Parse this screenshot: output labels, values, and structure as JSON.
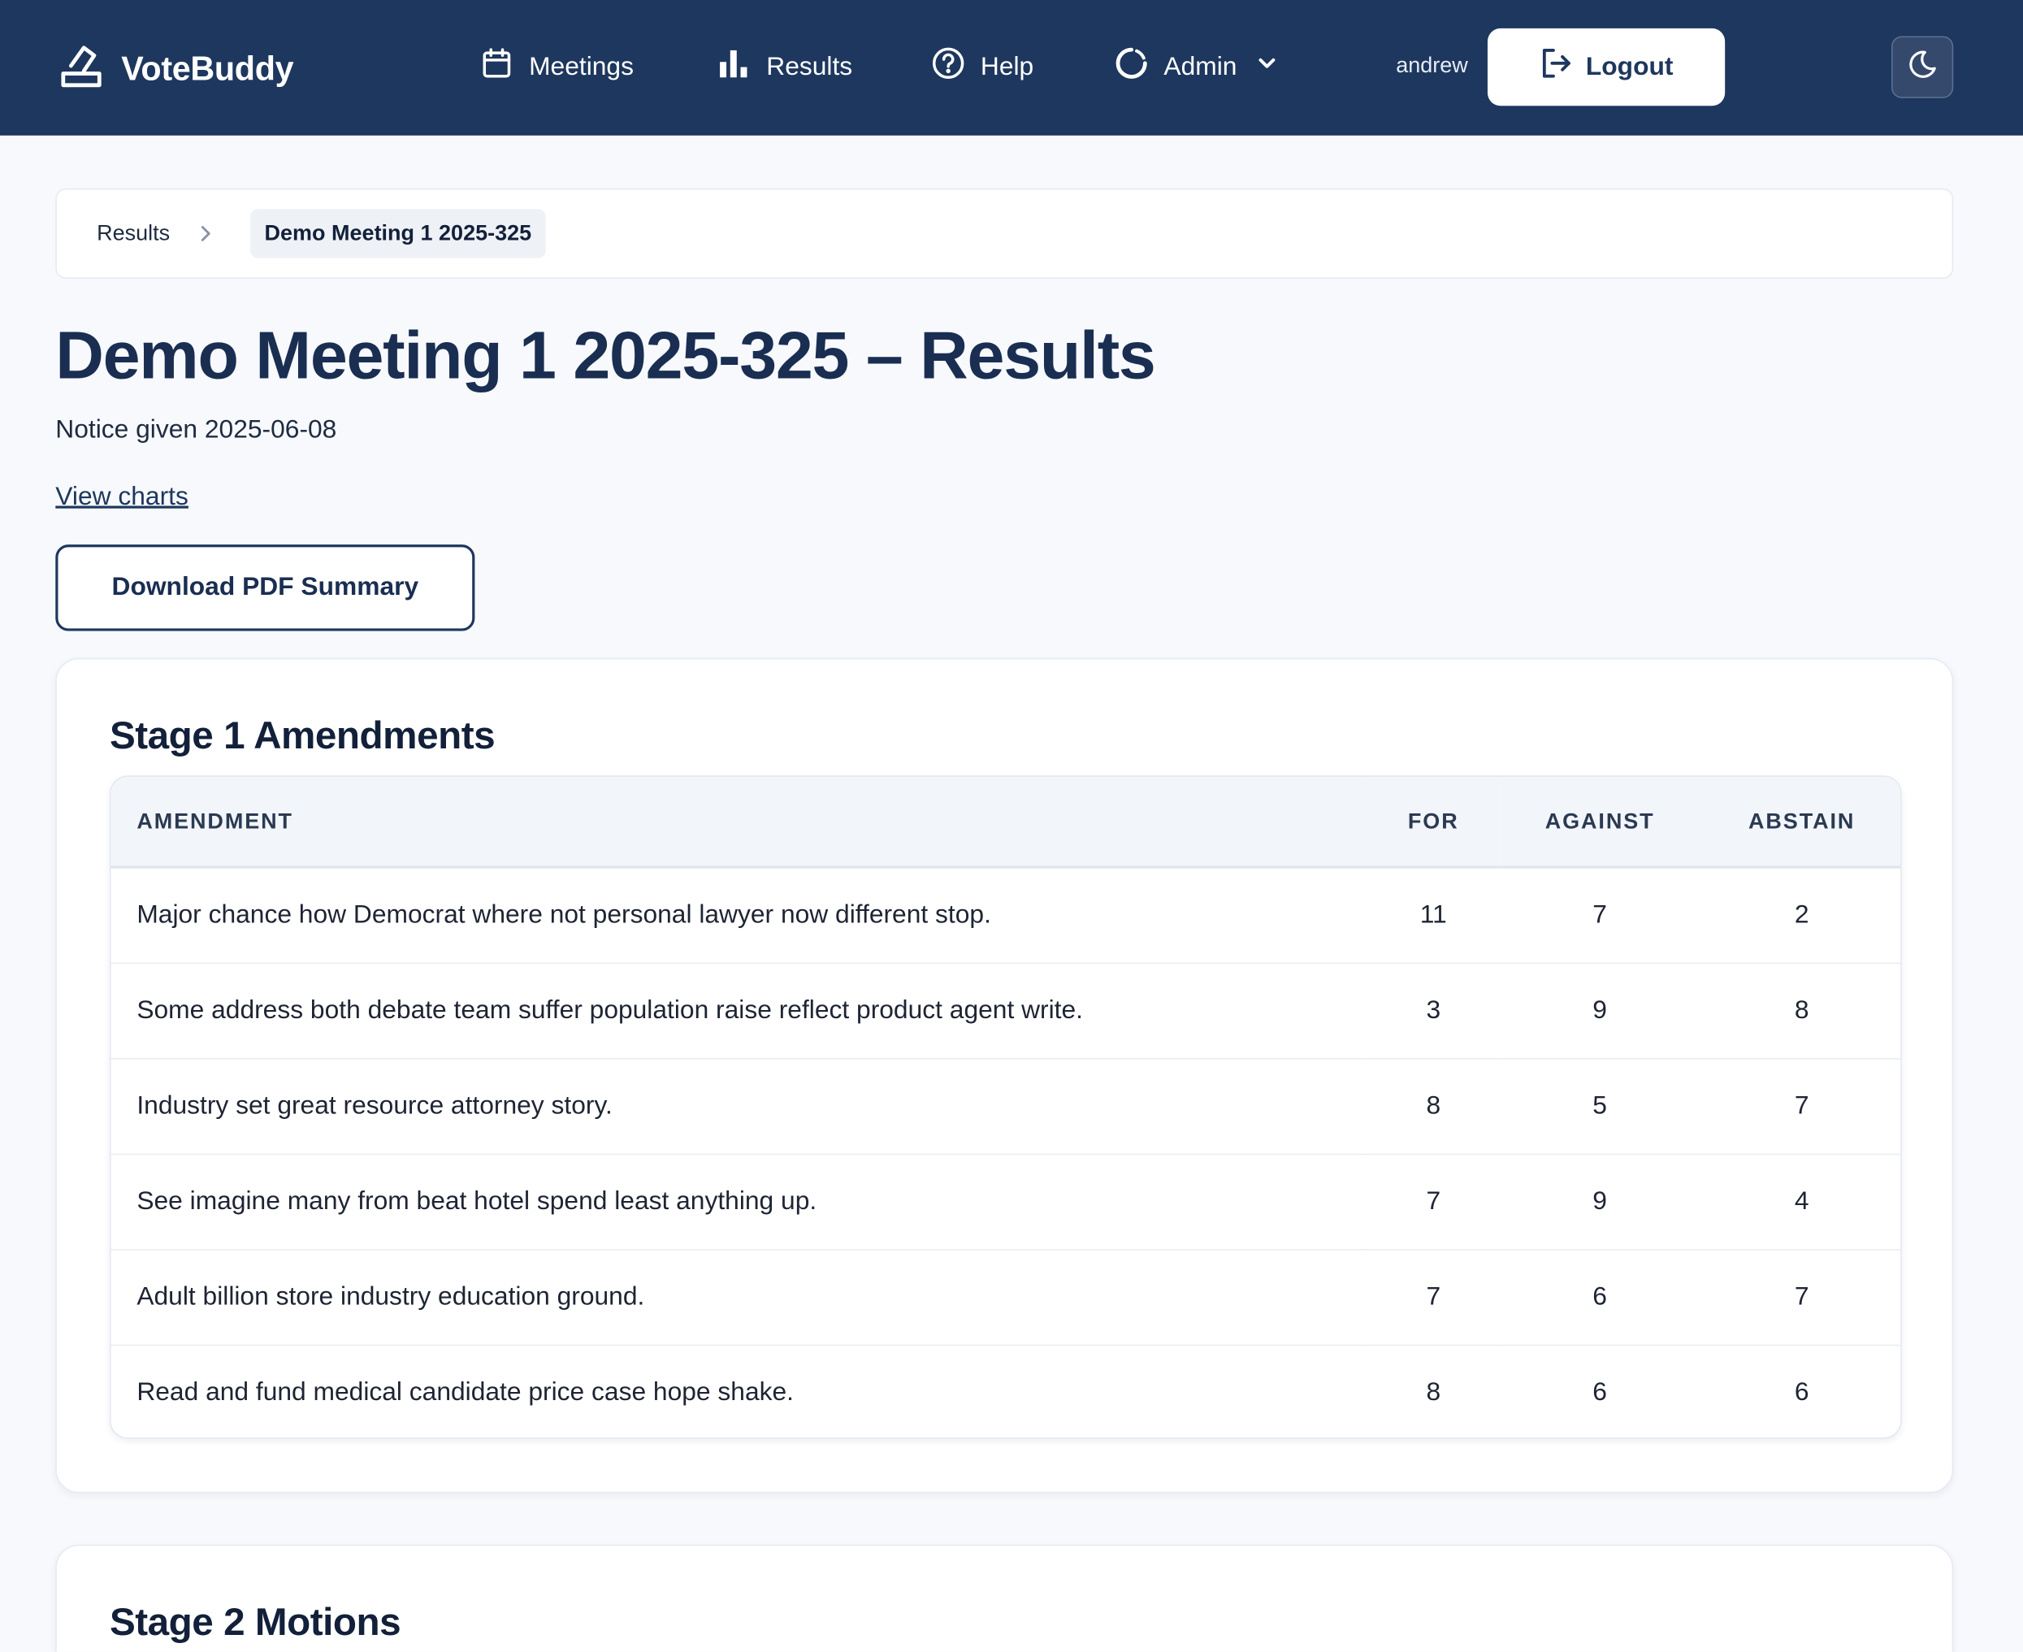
{
  "navbar": {
    "brand": "VoteBuddy",
    "items": [
      {
        "label": "Meetings",
        "icon": "calendar-icon"
      },
      {
        "label": "Results",
        "icon": "bar-chart-icon"
      },
      {
        "label": "Help",
        "icon": "question-circle-icon"
      },
      {
        "label": "Admin",
        "icon": "spinner-icon"
      }
    ],
    "username": "andrew",
    "logout_label": "Logout",
    "theme_toggle_icon": "moon-icon"
  },
  "colors": {
    "navbar_bg": "#1e375e",
    "page_bg": "#f7f9fc",
    "title": "#1a2e52"
  },
  "breadcrumb": {
    "parent": "Results",
    "current": "Demo Meeting 1 2025-325"
  },
  "page": {
    "title": "Demo Meeting 1 2025-325 – Results",
    "notice": "Notice given 2025-06-08",
    "view_charts": "View charts",
    "download_label": "Download PDF Summary"
  },
  "stage1": {
    "title": "Stage 1 Amendments",
    "columns": [
      "AMENDMENT",
      "FOR",
      "AGAINST",
      "ABSTAIN"
    ],
    "rows": [
      {
        "amendment": "Major chance how Democrat where not personal lawyer now different stop.",
        "for": "11",
        "against": "7",
        "abstain": "2"
      },
      {
        "amendment": "Some address both debate team suffer population raise reflect product agent write.",
        "for": "3",
        "against": "9",
        "abstain": "8"
      },
      {
        "amendment": "Industry set great resource attorney story.",
        "for": "8",
        "against": "5",
        "abstain": "7"
      },
      {
        "amendment": "See imagine many from beat hotel spend least anything up.",
        "for": "7",
        "against": "9",
        "abstain": "4"
      },
      {
        "amendment": "Adult billion store industry education ground.",
        "for": "7",
        "against": "6",
        "abstain": "7"
      },
      {
        "amendment": "Read and fund medical candidate price case hope shake.",
        "for": "8",
        "against": "6",
        "abstain": "6"
      }
    ]
  },
  "stage2": {
    "title": "Stage 2 Motions"
  }
}
